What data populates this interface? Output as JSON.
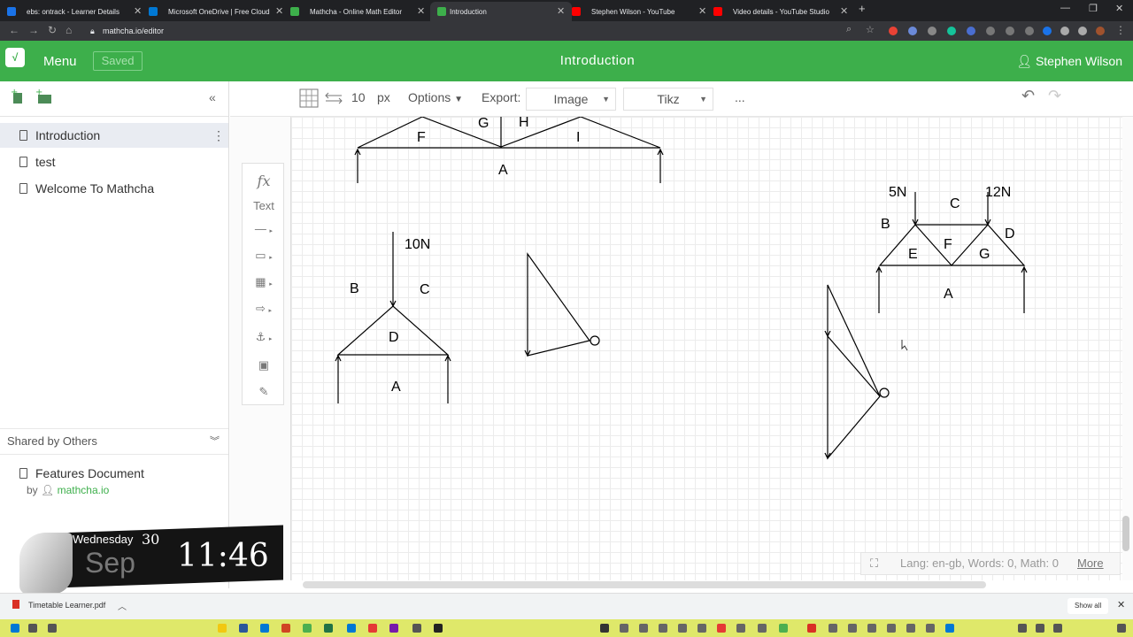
{
  "browser": {
    "tabs": [
      {
        "title": "ebs: ontrack - Learner Details",
        "favicon_color": "#1a73e8"
      },
      {
        "title": "Microsoft OneDrive | Free Cloud",
        "favicon_color": "#0078d4"
      },
      {
        "title": "Mathcha - Online Math Editor",
        "favicon_color": "#3daf4b"
      },
      {
        "title": "Introduction",
        "favicon_color": "#3daf4b",
        "active": true
      },
      {
        "title": "Stephen Wilson - YouTube",
        "favicon_color": "#ff0000"
      },
      {
        "title": "Video details - YouTube Studio",
        "favicon_color": "#ff0000"
      }
    ],
    "new_tab": "+",
    "url": "mathcha.io/editor"
  },
  "app": {
    "menu_label": "Menu",
    "saved_label": "Saved",
    "doc_title": "Introduction",
    "user_name": "Stephen Wilson",
    "brand_color": "#3daf4b"
  },
  "sidebar": {
    "collapse_glyph": "«",
    "documents": [
      {
        "label": "Introduction",
        "selected": true
      },
      {
        "label": "test"
      },
      {
        "label": "Welcome To Mathcha"
      }
    ],
    "shared_heading": "Shared by Others",
    "shared_docs": [
      {
        "label": "Features Document",
        "by_prefix": "by",
        "owner": "mathcha.io"
      }
    ]
  },
  "toolbar": {
    "grid_size": "10",
    "grid_unit": "px",
    "options_label": "Options",
    "export_label": "Export:",
    "export_image": "Image",
    "export_tikz": "Tikz",
    "more": "..."
  },
  "draw_panel": {
    "fx_label": "fx",
    "text_label": "Text"
  },
  "diagram_labels": {
    "top_truss": [
      "F",
      "G",
      "H",
      "I",
      "A"
    ],
    "left_truss": [
      "10N",
      "B",
      "C",
      "D",
      "A"
    ],
    "right_truss": [
      "5N",
      "12N",
      "C",
      "B",
      "D",
      "F",
      "E",
      "G",
      "A"
    ]
  },
  "status": {
    "text": "Lang: en-gb, Words: 0, Math: 0",
    "more_link": "More"
  },
  "clock_widget": {
    "day": "Wednesday",
    "date": "30",
    "month": "Sep",
    "time": "11:46"
  },
  "download_bar": {
    "file": "Timetable Learner.pdf",
    "show_all": "Show all"
  }
}
